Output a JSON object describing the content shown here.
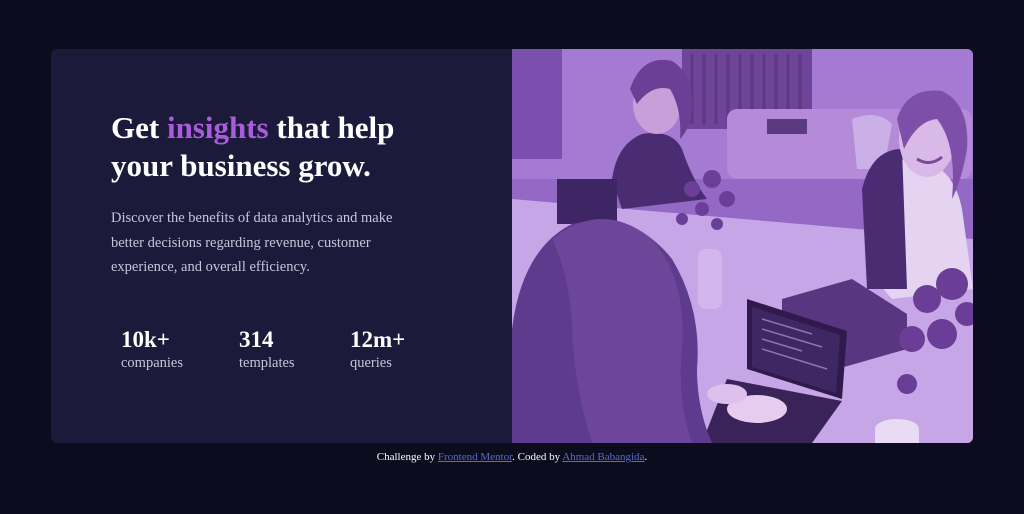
{
  "headline": {
    "before": "Get ",
    "accent": "insights",
    "after": " that help your business grow."
  },
  "description": "Discover the benefits of data analytics and make better decisions regarding revenue, customer experience, and overall efficiency.",
  "stats": [
    {
      "value": "10k+",
      "label": "companies"
    },
    {
      "value": "314",
      "label": "templates"
    },
    {
      "value": "12m+",
      "label": "queries"
    }
  ],
  "attribution": {
    "prefix": "Challenge by ",
    "link1": "Frontend Mentor",
    "middle": ". Coded by ",
    "link2": "Ahmad Babangida",
    "suffix": "."
  },
  "colors": {
    "page_bg": "#0b0c1d",
    "card_bg": "#1b1a3a",
    "accent": "#aa5cdb",
    "image_tint": "#8c5cbf",
    "link": "#5b6cd0"
  }
}
